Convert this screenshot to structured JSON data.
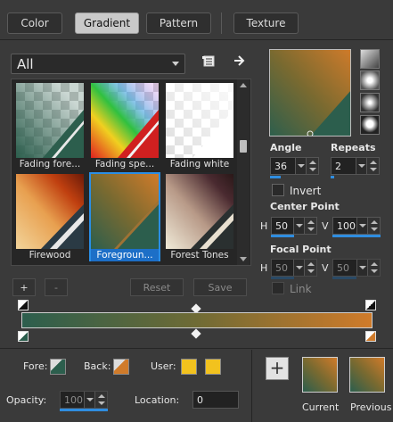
{
  "tabs": [
    {
      "label": "Color",
      "active": false
    },
    {
      "label": "Gradient",
      "active": true
    },
    {
      "label": "Pattern",
      "active": false
    },
    {
      "label": "Texture",
      "active": false
    }
  ],
  "category": {
    "selected": "All"
  },
  "gallery": {
    "items": [
      {
        "label": "Fading fore..."
      },
      {
        "label": "Fading spe..."
      },
      {
        "label": "Fading white"
      },
      {
        "label": "Firewood"
      },
      {
        "label": "Foregroun...",
        "selected": true
      },
      {
        "label": "Forest Tones"
      }
    ]
  },
  "gallery_buttons": {
    "add": "+",
    "remove": "-",
    "reset": "Reset",
    "save": "Save"
  },
  "angle": {
    "label": "Angle",
    "value": "36"
  },
  "repeats": {
    "label": "Repeats",
    "value": "2"
  },
  "invert": {
    "label": "Invert",
    "checked": false
  },
  "center_point": {
    "label": "Center Point",
    "h_label": "H",
    "h_value": "50",
    "v_label": "V",
    "v_value": "100"
  },
  "focal_point": {
    "label": "Focal Point",
    "h_label": "H",
    "h_value": "50",
    "v_label": "V",
    "v_value": "50"
  },
  "link": {
    "label": "Link",
    "checked": false
  },
  "materials": {
    "fore_label": "Fore:",
    "back_label": "Back:",
    "user_label": "User:",
    "opacity_label": "Opacity:",
    "opacity_value": "100",
    "location_label": "Location:",
    "location_value": "0"
  },
  "swatches": {
    "current_label": "Current",
    "previous_label": "Previous"
  },
  "colors": {
    "gradient_start": "#2c5e4d",
    "gradient_mid": "#6f6b35",
    "gradient_end": "#d07b2a",
    "user_color": "#f2c21e",
    "accent": "#2f8de0"
  }
}
